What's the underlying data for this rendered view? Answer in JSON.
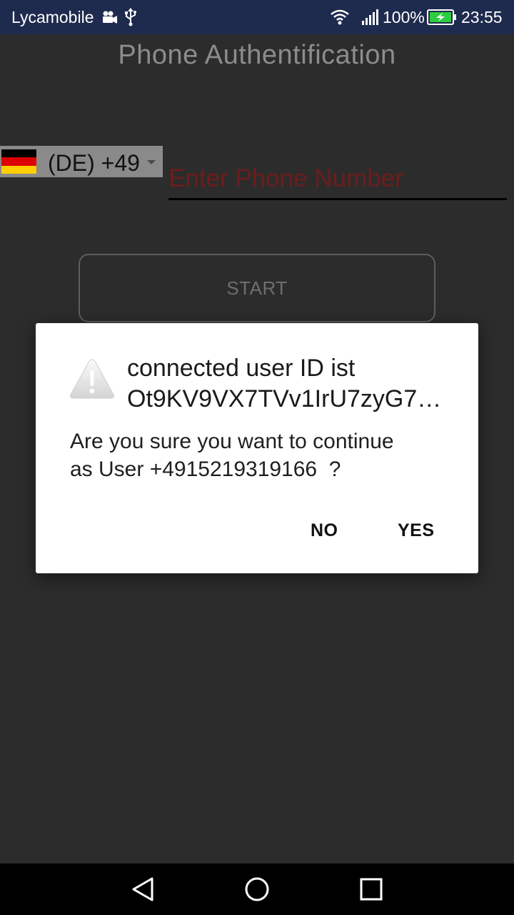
{
  "status_bar": {
    "carrier": "Lycamobile",
    "battery": "100%",
    "time": "23:55",
    "icons": [
      "video-camera-icon",
      "usb-icon",
      "wifi-icon",
      "signal-icon",
      "battery-charging-icon"
    ]
  },
  "app": {
    "title": "Phone Authentification",
    "country_code": "(DE) +49",
    "country_flag": [
      "#000000",
      "#dd0000",
      "#ffce00"
    ],
    "phone_placeholder": "Enter Phone Number",
    "start_label": "START"
  },
  "dialog": {
    "icon": "warning-icon",
    "title_line1": "connected user ID ist",
    "title_line2": "Ot9KV9VX7TVv1IrU7zyG7…",
    "message_line1": "Are you sure you want to continue",
    "message_line2": "as User +4915219319166  ?",
    "no_label": "NO",
    "yes_label": "YES"
  },
  "nav_bar": {
    "icons": [
      "back-icon",
      "home-icon",
      "recents-icon"
    ]
  },
  "colors": {
    "status_bar": "#1f2b4e",
    "background": "#2c2c2c",
    "placeholder": "#6e1c1c",
    "battery": "#2ecc40"
  }
}
